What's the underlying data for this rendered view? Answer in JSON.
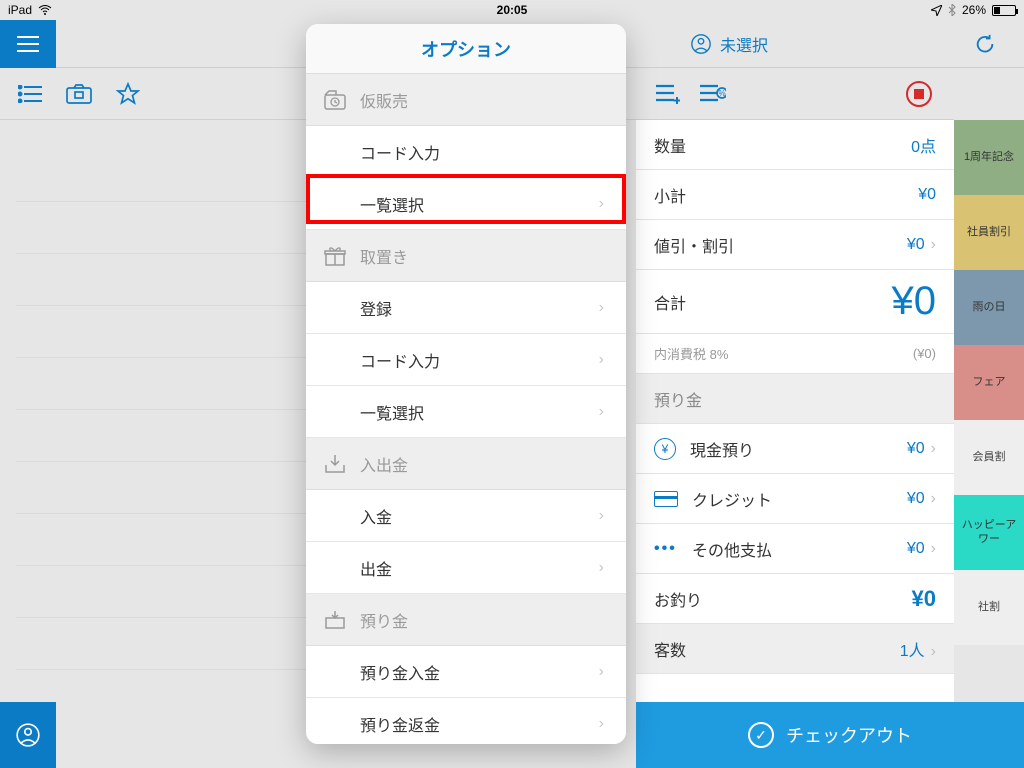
{
  "status": {
    "carrier": "iPad",
    "time": "20:05",
    "battery_pct": "26%"
  },
  "topnav": {
    "member_label": "未選択"
  },
  "popover": {
    "title": "オプション",
    "sections": [
      {
        "header": "仮販売",
        "items": [
          "コード入力",
          "一覧選択"
        ]
      },
      {
        "header": "取置き",
        "items": [
          "登録",
          "コード入力",
          "一覧選択"
        ]
      },
      {
        "header": "入出金",
        "items": [
          "入金",
          "出金"
        ]
      },
      {
        "header": "預り金",
        "items": [
          "預り金入金",
          "預り金返金"
        ]
      }
    ],
    "highlighted_item": "一覧選択"
  },
  "summary": {
    "rows": {
      "qty_label": "数量",
      "qty_value": "0点",
      "subtotal_label": "小計",
      "subtotal_value": "¥0",
      "discount_label": "値引・割引",
      "discount_value": "¥0",
      "total_label": "合計",
      "total_value": "¥0",
      "tax_label": "内消費税 8%",
      "tax_value": "(¥0)",
      "deposit_header": "預り金",
      "cash_label": "現金預り",
      "cash_value": "¥0",
      "credit_label": "クレジット",
      "credit_value": "¥0",
      "other_label": "その他支払",
      "other_value": "¥0",
      "change_label": "お釣り",
      "change_value": "¥0",
      "guests_label": "客数",
      "guests_value": "1人"
    }
  },
  "categories": [
    {
      "label": "1周年記念",
      "color": "#8fae83"
    },
    {
      "label": "社員割引",
      "color": "#d9c271"
    },
    {
      "label": "雨の日",
      "color": "#7d98ad"
    },
    {
      "label": "フェア",
      "color": "#d98f89"
    },
    {
      "label": "会員割",
      "color": "#eeeeee"
    },
    {
      "label": "ハッピーアワー",
      "color": "#2ad9c6"
    },
    {
      "label": "社割",
      "color": "#eeeeee"
    }
  ],
  "checkout": {
    "label": "チェックアウト"
  }
}
